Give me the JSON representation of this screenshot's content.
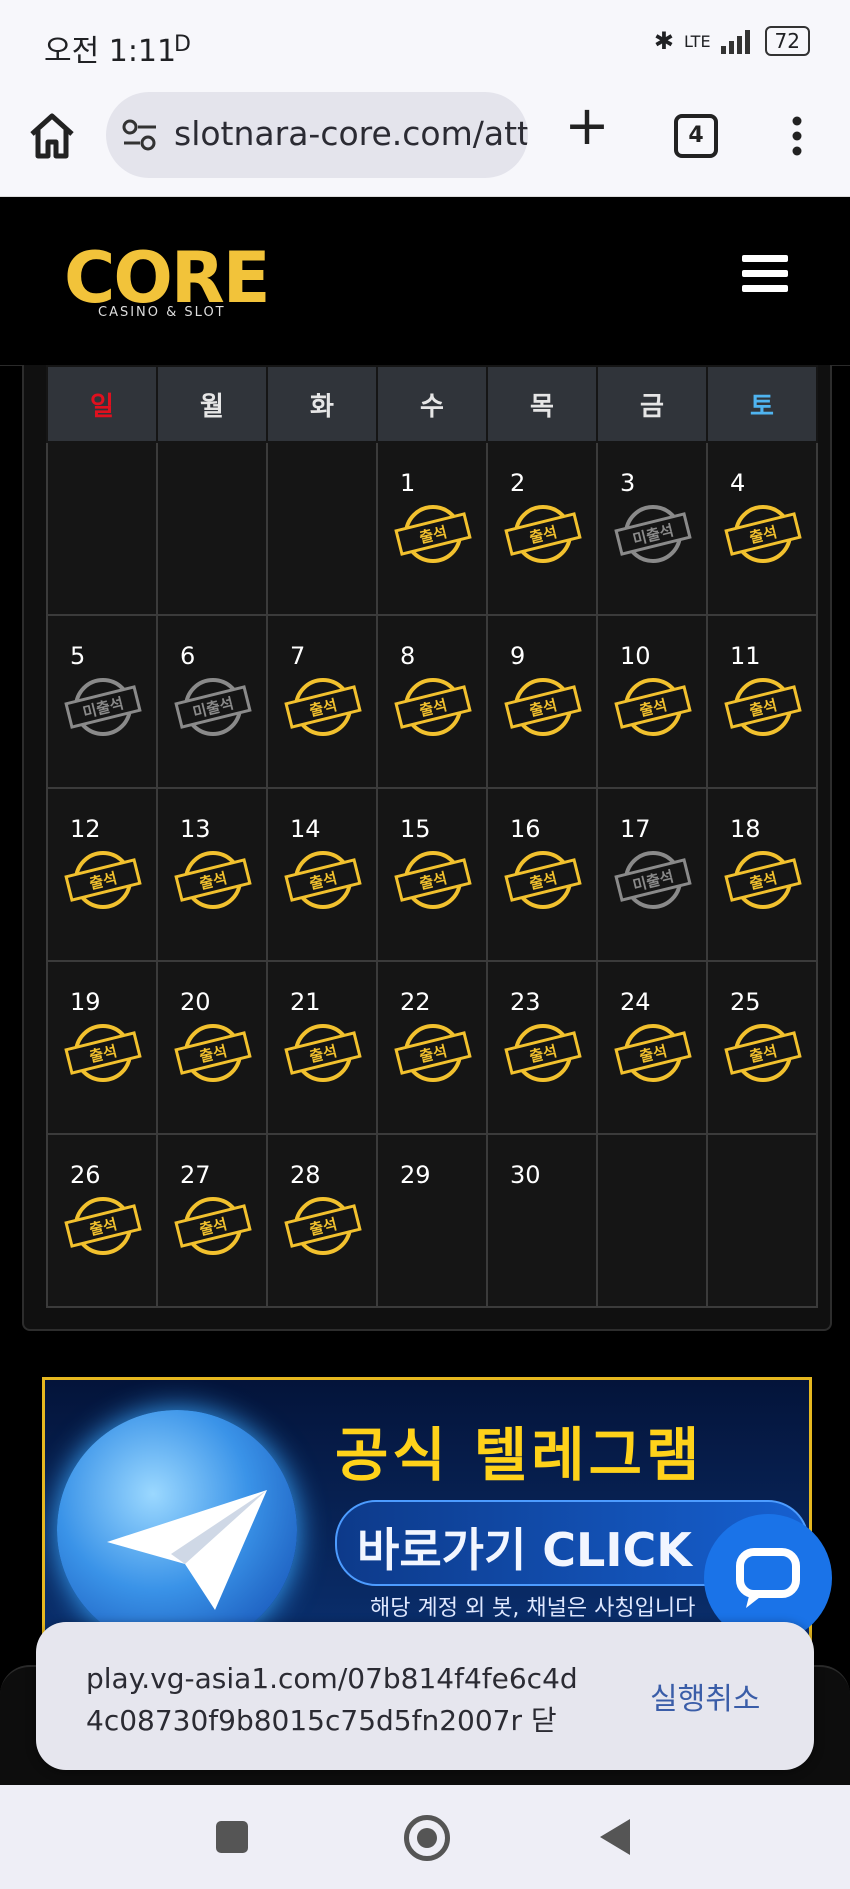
{
  "status_bar": {
    "time": "오전 1:11",
    "indicator": "D",
    "network": "LTE",
    "battery": "72"
  },
  "browser": {
    "url": "slotnara-core.com/att",
    "tab_count": "4"
  },
  "site": {
    "logo_text": "CORE",
    "logo_subtext": "CASINO & SLOT"
  },
  "calendar": {
    "weekdays": [
      "일",
      "월",
      "화",
      "수",
      "목",
      "금",
      "토"
    ],
    "weeks": [
      [
        {
          "day": ""
        },
        {
          "day": ""
        },
        {
          "day": ""
        },
        {
          "day": "1",
          "stamp": "출석"
        },
        {
          "day": "2",
          "stamp": "출석"
        },
        {
          "day": "3",
          "stamp": "미출석"
        },
        {
          "day": "4",
          "stamp": "출석"
        }
      ],
      [
        {
          "day": "5",
          "stamp": "미출석"
        },
        {
          "day": "6",
          "stamp": "미출석"
        },
        {
          "day": "7",
          "stamp": "출석"
        },
        {
          "day": "8",
          "stamp": "출석"
        },
        {
          "day": "9",
          "stamp": "출석"
        },
        {
          "day": "10",
          "stamp": "출석"
        },
        {
          "day": "11",
          "stamp": "출석"
        }
      ],
      [
        {
          "day": "12",
          "stamp": "출석"
        },
        {
          "day": "13",
          "stamp": "출석"
        },
        {
          "day": "14",
          "stamp": "출석"
        },
        {
          "day": "15",
          "stamp": "출석"
        },
        {
          "day": "16",
          "stamp": "출석"
        },
        {
          "day": "17",
          "stamp": "미출석"
        },
        {
          "day": "18",
          "stamp": "출석"
        }
      ],
      [
        {
          "day": "19",
          "stamp": "출석"
        },
        {
          "day": "20",
          "stamp": "출석"
        },
        {
          "day": "21",
          "stamp": "출석"
        },
        {
          "day": "22",
          "stamp": "출석"
        },
        {
          "day": "23",
          "stamp": "출석"
        },
        {
          "day": "24",
          "stamp": "출석"
        },
        {
          "day": "25",
          "stamp": "출석"
        }
      ],
      [
        {
          "day": "26",
          "stamp": "출석"
        },
        {
          "day": "27",
          "stamp": "출석"
        },
        {
          "day": "28",
          "stamp": "출석"
        },
        {
          "day": "29"
        },
        {
          "day": "30"
        },
        {
          "day": ""
        },
        {
          "day": ""
        }
      ]
    ]
  },
  "banner": {
    "title": "공식 텔레그램",
    "cta": "바로가기 CLICK",
    "note": "해당 계정 외 봇, 채널은 사칭입니다"
  },
  "toast": {
    "message": "play.vg-asia1.com/07b814f4fe6c4d4c08730f9b8015c75d5fn2007r 닫",
    "action": "실행취소"
  },
  "colors": {
    "attended": "#f2c12e",
    "absent": "#8a8a8a",
    "sunday": "#e0101e",
    "saturday": "#4fb4f0"
  }
}
